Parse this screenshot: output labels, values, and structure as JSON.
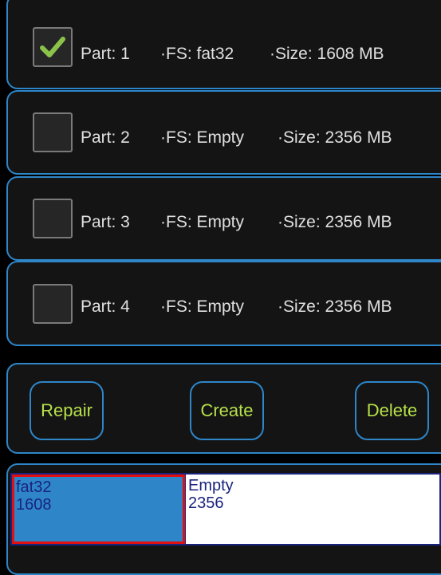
{
  "partitions": [
    {
      "part": "Part: 1",
      "fs": "·FS: fat32",
      "size": "·Size: 1608 MB",
      "checked": true
    },
    {
      "part": "Part: 2",
      "fs": "·FS: Empty",
      "size": "·Size: 2356 MB",
      "checked": false
    },
    {
      "part": "Part: 3",
      "fs": "·FS: Empty",
      "size": "·Size: 2356 MB",
      "checked": false
    },
    {
      "part": "Part: 4",
      "fs": "·FS: Empty",
      "size": "·Size: 2356 MB",
      "checked": false
    }
  ],
  "buttons": {
    "repair": "Repair",
    "create": "Create",
    "delete": "Delete"
  },
  "bar": {
    "segments": [
      {
        "fs": "fat32",
        "size": "1608",
        "selected": true
      },
      {
        "fs": "Empty",
        "size": "2356",
        "selected": false
      }
    ]
  },
  "colors": {
    "accent": "#2e86c8",
    "button_text": "#b6e04a",
    "check": "#8bc34a",
    "selection": "#e01010",
    "bar_text": "#1a237e"
  }
}
